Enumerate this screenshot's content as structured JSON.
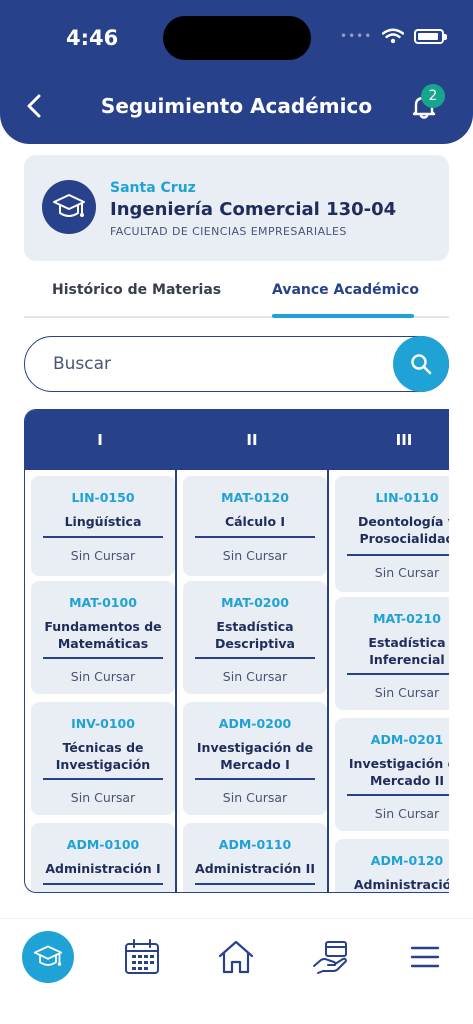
{
  "status": {
    "time": "4:46"
  },
  "header": {
    "title": "Seguimiento Académico",
    "notifications_count": "2"
  },
  "career": {
    "campus": "Santa Cruz",
    "name": "Ingeniería Comercial 130-04",
    "faculty": "FACULTAD DE CIENCIAS EMPRESARIALES"
  },
  "tabs": [
    {
      "label": "Histórico de Materias"
    },
    {
      "label": "Avance Académico"
    }
  ],
  "search": {
    "placeholder": "Buscar"
  },
  "semesters": [
    {
      "label": "I",
      "courses": [
        {
          "code": "LIN-0150",
          "name": "Lingüística",
          "status": "Sin Cursar"
        },
        {
          "code": "MAT-0100",
          "name": "Fundamentos de Matemáticas",
          "status": "Sin Cursar"
        },
        {
          "code": "INV-0100",
          "name": "Técnicas de Investigación",
          "status": "Sin Cursar"
        },
        {
          "code": "ADM-0100",
          "name": "Administración I",
          "status": ""
        }
      ]
    },
    {
      "label": "II",
      "courses": [
        {
          "code": "MAT-0120",
          "name": "Cálculo I",
          "status": "Sin Cursar"
        },
        {
          "code": "MAT-0200",
          "name": "Estadística Descriptiva",
          "status": "Sin Cursar"
        },
        {
          "code": "ADM-0200",
          "name": "Investigación de Mercado I",
          "status": "Sin Cursar"
        },
        {
          "code": "ADM-0110",
          "name": "Administración II",
          "status": ""
        }
      ]
    },
    {
      "label": "III",
      "courses": [
        {
          "code": "LIN-0110",
          "name": "Deontología y Prosocialidad",
          "status": "Sin Cursar"
        },
        {
          "code": "MAT-0210",
          "name": "Estadística Inferencial",
          "status": "Sin Cursar"
        },
        {
          "code": "ADM-0201",
          "name": "Investigación de Mercado II",
          "status": "Sin Cursar"
        },
        {
          "code": "ADM-0120",
          "name": "Administración",
          "status": ""
        }
      ]
    }
  ],
  "nav": [
    {
      "icon": "graduation-cap-icon",
      "active": true
    },
    {
      "icon": "calendar-icon",
      "active": false
    },
    {
      "icon": "home-icon",
      "active": false
    },
    {
      "icon": "payment-hand-icon",
      "active": false
    },
    {
      "icon": "menu-icon",
      "active": false
    }
  ],
  "colors": {
    "primary": "#27418b",
    "accent": "#1fa3d6",
    "card": "#e9edf4",
    "badge": "#16a58d"
  }
}
